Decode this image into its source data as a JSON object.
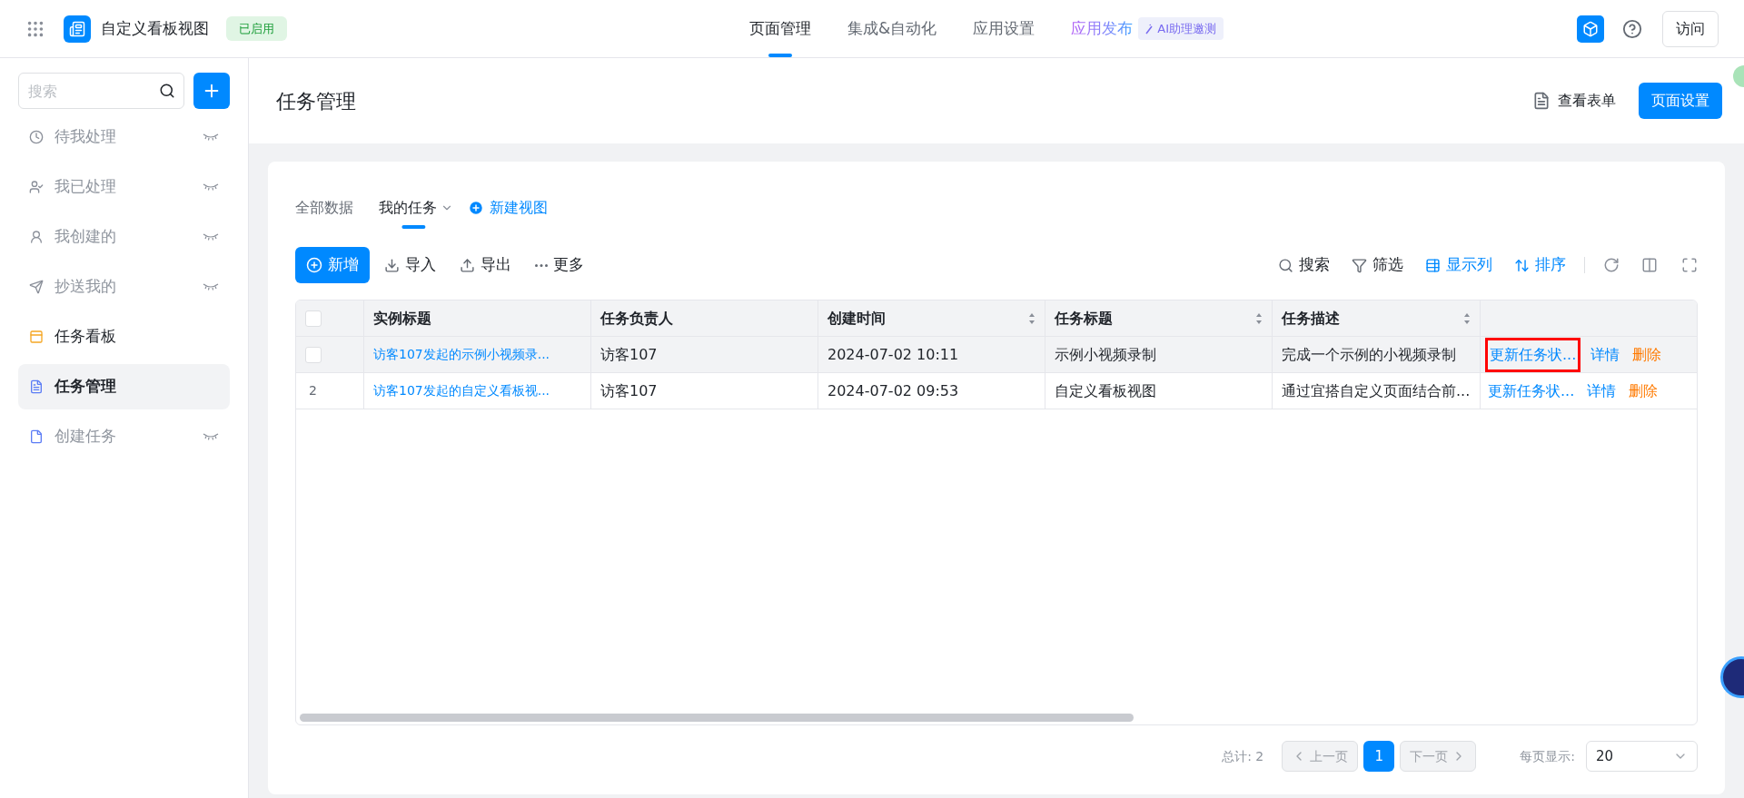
{
  "app": {
    "title": "自定义看板视图",
    "status": "已启用"
  },
  "nav_tabs": [
    {
      "label": "页面管理",
      "selected": true,
      "kind": "plain"
    },
    {
      "label": "集成&自动化",
      "selected": false,
      "kind": "plain"
    },
    {
      "label": "应用设置",
      "selected": false,
      "kind": "plain"
    },
    {
      "label": "应用发布",
      "selected": false,
      "kind": "publish",
      "badge": "AI助理邀测"
    }
  ],
  "visit_button": "访问",
  "sidebar": {
    "search": {
      "placeholder": "搜索"
    },
    "items": [
      {
        "label": "待我处理",
        "selected": false,
        "hidden": true
      },
      {
        "label": "我已处理",
        "selected": false,
        "hidden": true
      },
      {
        "label": "我创建的",
        "selected": false,
        "hidden": true
      },
      {
        "label": "抄送我的",
        "selected": false,
        "hidden": true
      },
      {
        "label": "任务看板",
        "selected": false,
        "hidden": false
      },
      {
        "label": "任务管理",
        "selected": true,
        "hidden": false
      },
      {
        "label": "创建任务",
        "selected": false,
        "hidden": true
      }
    ]
  },
  "page": {
    "title": "任务管理",
    "view_form": "查看表单",
    "settings": "页面设置"
  },
  "view_tabs": [
    {
      "label": "全部数据",
      "selected": false
    },
    {
      "label": "我的任务",
      "selected": true
    }
  ],
  "new_view": "新建视图",
  "toolbar_left": [
    {
      "label": "新增",
      "kind": "primary"
    },
    {
      "label": "导入",
      "kind": "import"
    },
    {
      "label": "导出",
      "kind": "export"
    },
    {
      "label": "更多",
      "kind": "more"
    }
  ],
  "toolbar_right": [
    {
      "label": "搜索",
      "kind": "search",
      "active": false
    },
    {
      "label": "筛选",
      "kind": "filter",
      "active": false
    },
    {
      "label": "显示列",
      "kind": "columns",
      "active": true
    },
    {
      "label": "排序",
      "kind": "sort",
      "active": true
    }
  ],
  "table": {
    "select_all_checked": false,
    "columns": [
      {
        "label": "实例标题",
        "sortable": false
      },
      {
        "label": "任务负责人",
        "sortable": false
      },
      {
        "label": "创建时间",
        "sortable": true
      },
      {
        "label": "任务标题",
        "sortable": true
      },
      {
        "label": "任务描述",
        "sortable": true
      }
    ],
    "rows": [
      {
        "hovered": true,
        "checked": false,
        "cells": [
          "访客107发起的示例小视频录...",
          "访客107",
          "2024-07-02 10:11",
          "示例小视频录制",
          "完成一个示例的小视频录制"
        ],
        "actions": [
          {
            "label": "更新任务状...",
            "kind": "link",
            "highlighted": true
          },
          {
            "label": "详情",
            "kind": "link",
            "highlighted": false
          },
          {
            "label": "删除",
            "kind": "danger",
            "highlighted": false
          }
        ]
      },
      {
        "hovered": false,
        "checked": false,
        "index": "2",
        "cells": [
          "访客107发起的自定义看板视...",
          "访客107",
          "2024-07-02 09:53",
          "自定义看板视图",
          "通过宜搭自定义页面结合前..."
        ],
        "actions": [
          {
            "label": "更新任务状...",
            "kind": "link",
            "highlighted": false
          },
          {
            "label": "详情",
            "kind": "link",
            "highlighted": false
          },
          {
            "label": "删除",
            "kind": "danger",
            "highlighted": false
          }
        ]
      }
    ]
  },
  "pagination": {
    "total": "总计: 2",
    "prev": "上一页",
    "pages": [
      {
        "label": "1",
        "selected": true
      }
    ],
    "next": "下一页",
    "page_size_label": "每页显示:",
    "page_size": "20"
  }
}
